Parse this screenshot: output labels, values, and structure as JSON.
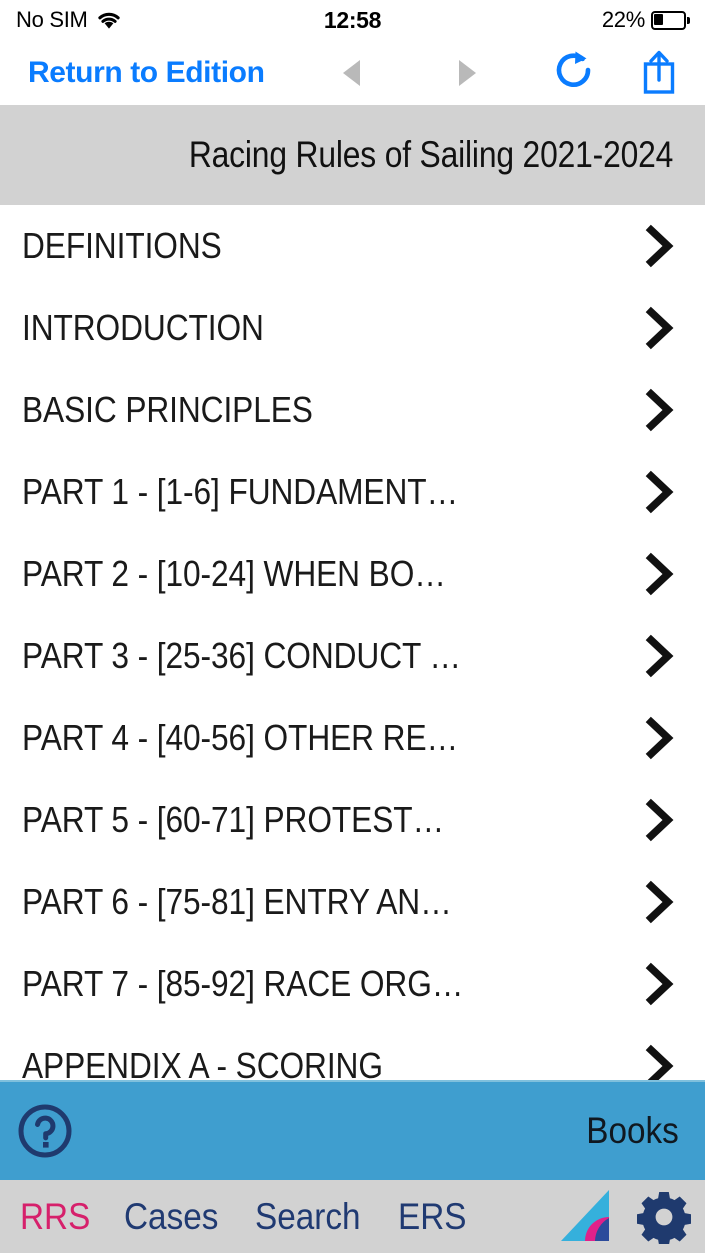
{
  "status_bar": {
    "carrier": "No SIM",
    "wifi_icon": "wifi-icon",
    "time": "12:58",
    "battery_percent": "22%",
    "battery_icon": "battery-icon"
  },
  "nav_bar": {
    "back_label": "Return to Edition",
    "back_arrow_icon": "triangle-left-icon",
    "forward_arrow_icon": "triangle-right-icon",
    "reload_icon": "reload-icon",
    "share_icon": "share-icon",
    "accent_color": "#0a7cff",
    "disabled_color": "#b9b9b9"
  },
  "title_bar": {
    "title": "Racing Rules of Sailing 2021-2024",
    "background_color": "#d2d2d2"
  },
  "list": {
    "chevron_icon": "chevron-right-icon",
    "items": [
      {
        "label": "DEFINITIONS"
      },
      {
        "label": "INTRODUCTION"
      },
      {
        "label": "BASIC PRINCIPLES"
      },
      {
        "label": "PART 1 - [1-6] FUNDAMENT…"
      },
      {
        "label": "PART 2 - [10-24] WHEN BO…"
      },
      {
        "label": "PART 3 - [25-36] CONDUCT …"
      },
      {
        "label": "PART 4 - [40-56] OTHER RE…"
      },
      {
        "label": "PART 5 - [60-71] PROTEST…"
      },
      {
        "label": "PART 6 - [75-81] ENTRY AN…"
      },
      {
        "label": "PART 7 - [85-92] RACE ORG…"
      },
      {
        "label": "APPENDIX A - SCORING"
      }
    ]
  },
  "books_bar": {
    "help_icon": "help-circle-icon",
    "label": "Books",
    "background_color": "#3f9ecf"
  },
  "tab_bar": {
    "background_color": "#d2d2d2",
    "active_color": "#d6206b",
    "inactive_color": "#203a72",
    "tabs": [
      {
        "label": "RRS",
        "active": true
      },
      {
        "label": "Cases",
        "active": false
      },
      {
        "label": "Search",
        "active": false
      },
      {
        "label": "ERS",
        "active": false
      }
    ],
    "logo_icon": "sail-logo-icon",
    "settings_icon": "gear-icon"
  }
}
